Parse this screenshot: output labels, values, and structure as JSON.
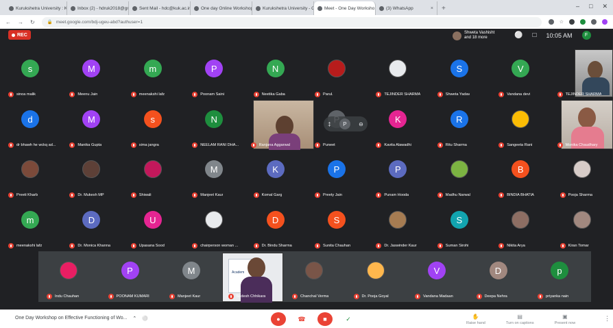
{
  "browser": {
    "tabs": [
      {
        "label": "Kurukshetra University : Kuruk",
        "active": false
      },
      {
        "label": "Inbox (2) - hdruk2018@gmail.",
        "active": false
      },
      {
        "label": "Sent Mail - hdc@kuk.ac.in - Ku",
        "active": false
      },
      {
        "label": "One day Online Workshop on",
        "active": false
      },
      {
        "label": "Kurukshetra University - Calend",
        "active": false
      },
      {
        "label": "Meet - One Day Worksho",
        "active": true
      },
      {
        "label": "(3) WhatsApp",
        "active": false
      }
    ],
    "url": "meet.google.com/bdj-ugeu-abd?authuser=1"
  },
  "meeting": {
    "rec_label": "REC",
    "presenter_line1": "Shweta Vashisht",
    "presenter_line2": "and 18 more",
    "time": "10:05 AM",
    "title": "One Day Workshop on Effective Functioning of Wo...",
    "account_initial": "F",
    "actions": [
      {
        "label": "Raise hand"
      },
      {
        "label": "Turn on captions"
      },
      {
        "label": "Present now"
      }
    ]
  },
  "rows": [
    [
      {
        "name": "sinoa malik",
        "initial": "s",
        "color": "#34a853"
      },
      {
        "name": "Meenu Jain",
        "initial": "M",
        "color": "#a142f4"
      },
      {
        "name": "meenakshi lafz",
        "initial": "m",
        "color": "#34a853"
      },
      {
        "name": "Poonam Saini",
        "initial": "P",
        "color": "#a142f4"
      },
      {
        "name": "Neetika Gaba",
        "initial": "N",
        "color": "#34a853"
      },
      {
        "name": "Parul.",
        "initial": "",
        "color": "#b71c1c"
      },
      {
        "name": "TEJINDER SHARMA",
        "initial": "",
        "color": "#e8eaed"
      },
      {
        "name": "Shweta Yadav",
        "initial": "S",
        "color": "#1a73e8"
      },
      {
        "name": "Vandana devi",
        "initial": "V",
        "color": "#34a853"
      },
      {
        "name": "TEJINDER SHARMA",
        "initial": "",
        "color": "#6d7580"
      }
    ],
    [
      {
        "name": "dr bhawh he wckq ad...",
        "initial": "d",
        "color": "#1a73e8"
      },
      {
        "name": "Manika Gupta",
        "initial": "M",
        "color": "#a142f4"
      },
      {
        "name": "sima jangra",
        "initial": "s",
        "color": "#f4511e"
      },
      {
        "name": "NEELAM RANI DHA...",
        "initial": "N",
        "color": "#1e8e3e"
      },
      {
        "name": "Ranjana Aggarwal",
        "initial": "",
        "color": "#7a6a58"
      },
      {
        "name": "Puneet",
        "initial": "P",
        "color": "#5f6368"
      },
      {
        "name": "Kavita Alawadhi",
        "initial": "K",
        "color": "#e52592"
      },
      {
        "name": "Ritu Sharma",
        "initial": "R",
        "color": "#1a73e8"
      },
      {
        "name": "Sangeeta Rani",
        "initial": "",
        "color": "#fbbc04"
      },
      {
        "name": "Monika Chaudhary",
        "initial": "",
        "color": "#b89a8a"
      }
    ],
    [
      {
        "name": "Preeti Kharb",
        "initial": "",
        "color": "#7b4a3a"
      },
      {
        "name": "Dr. Mukesh MP",
        "initial": "",
        "color": "#5d4037"
      },
      {
        "name": "Shiwali",
        "initial": "",
        "color": "#c2185b"
      },
      {
        "name": "Manjeet Kaur",
        "initial": "M",
        "color": "#80868b"
      },
      {
        "name": "Komal Garg",
        "initial": "K",
        "color": "#5c6bc0"
      },
      {
        "name": "Preety Jain",
        "initial": "P",
        "color": "#1a73e8"
      },
      {
        "name": "Punam Hooda",
        "initial": "P",
        "color": "#5c6bc0"
      },
      {
        "name": "Madhu Narwal",
        "initial": "",
        "color": "#7cb342"
      },
      {
        "name": "BINDIA BHATIA",
        "initial": "B",
        "color": "#f4511e"
      },
      {
        "name": "Pooja Sharma",
        "initial": "",
        "color": "#d7ccc8"
      }
    ],
    [
      {
        "name": "meenakshi lafz",
        "initial": "m",
        "color": "#34a853"
      },
      {
        "name": "Dr. Monica Khanna",
        "initial": "D",
        "color": "#5c6bc0"
      },
      {
        "name": "Upasana Sood",
        "initial": "U",
        "color": "#e52592"
      },
      {
        "name": "chairperson woman ...",
        "initial": "",
        "color": "#e8eaed"
      },
      {
        "name": "Dr. Bindu Sharma",
        "initial": "D",
        "color": "#f4511e"
      },
      {
        "name": "Sunita Chauhan",
        "initial": "S",
        "color": "#f4511e"
      },
      {
        "name": "Dr. Jaswinder Kaur",
        "initial": "",
        "color": "#a67c52"
      },
      {
        "name": "Suman Sirohi",
        "initial": "S",
        "color": "#12a4af"
      },
      {
        "name": "Nikita Arya",
        "initial": "",
        "color": "#8d6e63"
      },
      {
        "name": "Kiran Tomar",
        "initial": "",
        "color": "#a1887f"
      }
    ],
    [
      {
        "name": "Indu Chauhan",
        "initial": "",
        "color": "#e91e63"
      },
      {
        "name": "POONAM KUMARI",
        "initial": "P",
        "color": "#a142f4"
      },
      {
        "name": "Manjeet Kaur",
        "initial": "M",
        "color": "#80868b"
      },
      {
        "name": "Sudesh Chhikara",
        "initial": "",
        "color": "#b0bec5"
      },
      {
        "name": "Chanchal Verma",
        "initial": "",
        "color": "#795548"
      },
      {
        "name": "Dr. Pooja Goyal",
        "initial": "",
        "color": "#ffb74d"
      },
      {
        "name": "Vandana Madaan",
        "initial": "V",
        "color": "#a142f4"
      },
      {
        "name": "Deepa Nehra",
        "initial": "D",
        "color": "#a1887f"
      },
      {
        "name": "priyanka nain",
        "initial": "p",
        "color": "#1e8e3e"
      }
    ]
  ],
  "video_text": {
    "slide_word": "Academ"
  }
}
